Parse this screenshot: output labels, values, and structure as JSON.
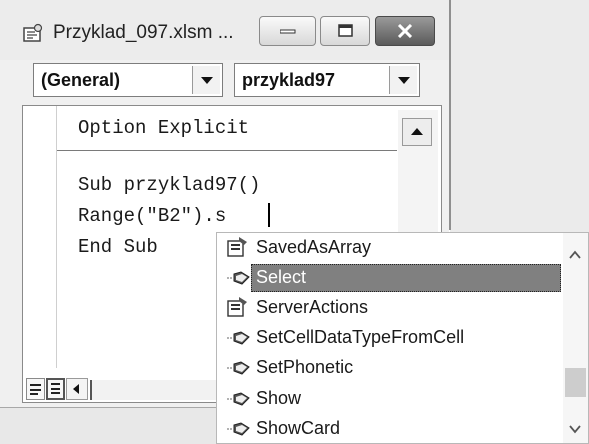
{
  "window": {
    "title": "Przyklad_097.xlsm ..."
  },
  "object_combo": {
    "value": "(General)"
  },
  "procedure_combo": {
    "value": "przyklad97"
  },
  "code": {
    "lines": [
      "Option Explicit",
      "Sub przyklad97()",
      "Range(\"B2\").s",
      "End Sub"
    ]
  },
  "autocomplete": {
    "items": [
      {
        "label": "SavedAsArray",
        "icon": "property-icon"
      },
      {
        "label": "Select",
        "icon": "method-icon",
        "selected": true
      },
      {
        "label": "ServerActions",
        "icon": "property-icon"
      },
      {
        "label": "SetCellDataTypeFromCell",
        "icon": "method-icon"
      },
      {
        "label": "SetPhonetic",
        "icon": "method-icon"
      },
      {
        "label": "Show",
        "icon": "method-icon"
      },
      {
        "label": "ShowCard",
        "icon": "method-icon"
      }
    ]
  },
  "colors": {
    "selection": "#808080",
    "close_button": "#5a5a5a"
  }
}
